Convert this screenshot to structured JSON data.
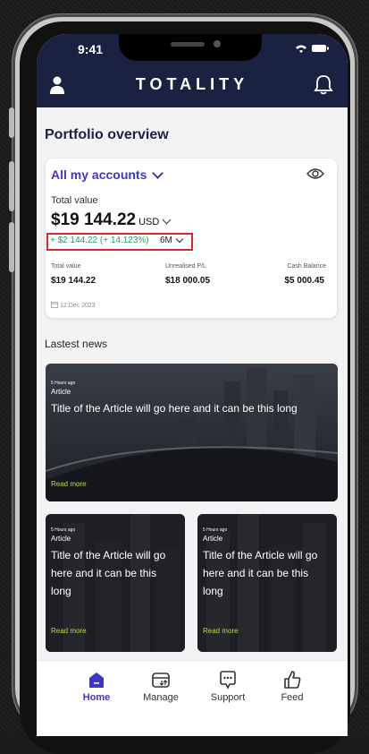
{
  "status_bar": {
    "time": "9:41"
  },
  "header": {
    "logo": "TOTALITY"
  },
  "portfolio": {
    "title": "Portfolio overview",
    "account_selector": "All my accounts",
    "total_value_label": "Total value",
    "total_value": "$19 144.22",
    "currency": "USD",
    "change": "+ $2 144.22 (+ 14.123%)",
    "change_color": "#27a35a",
    "period": "6M",
    "metrics": [
      {
        "label": "Total value",
        "value": "$19 144.22"
      },
      {
        "label": "Unrealised P/L",
        "value": "$18 000.05"
      },
      {
        "label": "Cash Balance",
        "value": "$5 000.45"
      }
    ],
    "date": "12 Dec 2023"
  },
  "news": {
    "title": "Lastest news",
    "articles": [
      {
        "time": "5 Hours ago",
        "kind": "Article",
        "headline": "Title of the Article will go here and it can be this long",
        "cta": "Read more"
      },
      {
        "time": "5 Hours ago",
        "kind": "Article",
        "headline": "Title of the Article will go here and it can be this long",
        "cta": "Read more"
      },
      {
        "time": "5 Hours ago",
        "kind": "Article",
        "headline": "Title of the Article will go here and it can be this long",
        "cta": "Read more"
      }
    ]
  },
  "nav": {
    "items": [
      {
        "label": "Home",
        "icon": "home-icon",
        "active": true
      },
      {
        "label": "Manage",
        "icon": "wallet-icon",
        "active": false
      },
      {
        "label": "Support",
        "icon": "chat-icon",
        "active": false
      },
      {
        "label": "Feed",
        "icon": "thumbs-up-icon",
        "active": false
      }
    ]
  },
  "colors": {
    "brand_dark": "#1b2140",
    "accent": "#3f35c6",
    "positive": "#27a35a",
    "highlight": "#e3232b",
    "read_more": "#b8d65a"
  }
}
